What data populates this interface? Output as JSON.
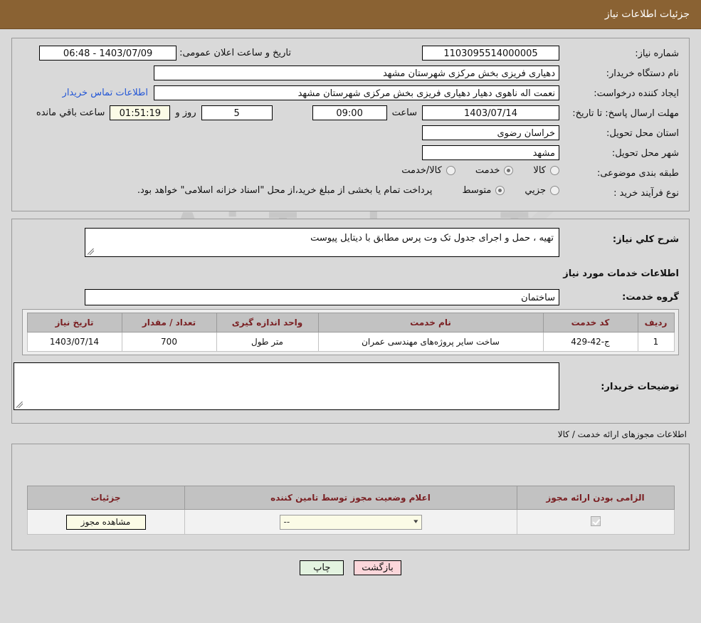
{
  "header": {
    "title": "جزئیات اطلاعات نیاز"
  },
  "summary": {
    "need_number_label": "شماره نیاز:",
    "need_number_value": "1103095514000005",
    "announce_label": "تاریخ و ساعت اعلان عمومی:",
    "announce_value": "1403/07/09 - 06:48",
    "buyer_org_label": "نام دستگاه خریدار:",
    "buyer_org_value": "دهیاری فریزی بخش مرکزی شهرستان مشهد",
    "creator_label": "ایجاد کننده درخواست:",
    "creator_value": "نعمت اله ناهوی دهیار دهیاری فریزی بخش مرکزی شهرستان مشهد",
    "contact_link": "اطلاعات تماس خریدار",
    "deadline_label": "مهلت ارسال پاسخ: تا تاریخ:",
    "deadline_date": "1403/07/14",
    "time_label": "ساعت",
    "deadline_time": "09:00",
    "days_value": "5",
    "days_label": "روز و",
    "countdown_value": "01:51:19",
    "countdown_label": "ساعت باقي مانده",
    "province_label": "استان محل تحویل:",
    "province_value": "خراسان رضوی",
    "city_label": "شهر محل تحویل:",
    "city_value": "مشهد",
    "category_label": "طبقه بندی موضوعی:",
    "category_options": [
      {
        "label": "کالا",
        "selected": false
      },
      {
        "label": "خدمت",
        "selected": true
      },
      {
        "label": "کالا/خدمت",
        "selected": false
      }
    ],
    "process_label": "نوع فرآیند خرید :",
    "process_options": [
      {
        "label": "جزیي",
        "selected": false
      },
      {
        "label": "متوسط",
        "selected": true
      }
    ],
    "process_note": "پرداخت تمام یا بخشی از مبلغ خرید،از محل \"اسناد خزانه اسلامی\" خواهد بود."
  },
  "details": {
    "general_desc_label": "شرح کلي نیاز:",
    "general_desc_value": "تهیه ، حمل و اجرای جدول تک وت پرس مطابق با دیتایل پیوست",
    "services_section_title": "اطلاعات خدمات مورد نیاز",
    "service_group_label": "گروه خدمت:",
    "service_group_value": "ساختمان",
    "table": {
      "columns": [
        "ردیف",
        "کد خدمت",
        "نام خدمت",
        "واحد اندازه گیری",
        "تعداد / مقدار",
        "تاریخ نیاز"
      ],
      "rows": [
        {
          "row": "1",
          "code": "ج-42-429",
          "name": "ساخت سایر پروژه‌های مهندسی عمران",
          "unit": "متر طول",
          "quantity": "700",
          "need_date": "1403/07/14"
        }
      ]
    },
    "buyer_notes_label": "توضیحات خریدار:",
    "buyer_notes_value": ""
  },
  "permits": {
    "section_label": "اطلاعات مجوزهای ارائه خدمت / کالا",
    "columns": [
      "الزامی بودن ارائه مجوز",
      "اعلام وضعیت مجوز توسط تامین کننده",
      "جزئیات"
    ],
    "rows": [
      {
        "required": true,
        "status_value": "--",
        "details_button": "مشاهده مجوز"
      }
    ]
  },
  "footer": {
    "print_label": "چاپ",
    "back_label": "بازگشت"
  },
  "watermark": {
    "text": "AriaTender.neT"
  },
  "colors": {
    "header_bg": "#8a6233",
    "page_bg": "#d9d9d9",
    "link": "#2457d6",
    "table_header_text": "#7a1f22",
    "print_btn": "#e3f3e0",
    "back_btn": "#fbd6da"
  }
}
